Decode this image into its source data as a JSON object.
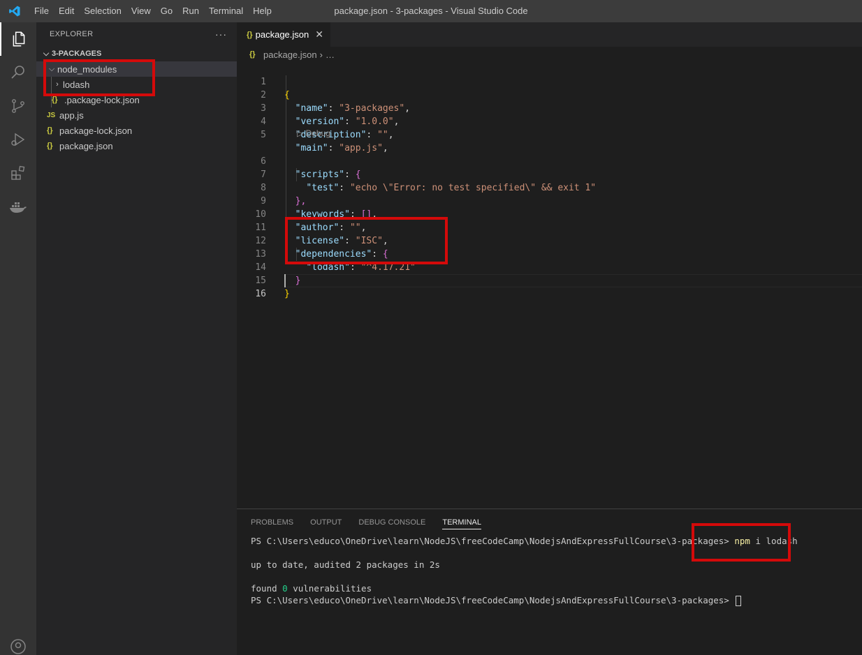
{
  "titlebar": {
    "menu": [
      "File",
      "Edit",
      "Selection",
      "View",
      "Go",
      "Run",
      "Terminal",
      "Help"
    ],
    "window_title": "package.json - 3-packages - Visual Studio Code"
  },
  "activitybar": {
    "icons": [
      "explorer-icon",
      "search-icon",
      "source-control-icon",
      "run-debug-icon",
      "extensions-icon",
      "docker-icon",
      "account-icon"
    ],
    "active": "explorer-icon"
  },
  "sidebar": {
    "title": "EXPLORER",
    "more": "···",
    "section": "3-PACKAGES",
    "tree": [
      {
        "label": "node_modules",
        "kind": "folder-open",
        "depth": 1
      },
      {
        "label": "lodash",
        "kind": "folder-closed",
        "depth": 2
      },
      {
        "label": ".package-lock.json",
        "kind": "json",
        "depth": 2
      },
      {
        "label": "app.js",
        "kind": "js",
        "depth": 1
      },
      {
        "label": "package-lock.json",
        "kind": "json",
        "depth": 1
      },
      {
        "label": "package.json",
        "kind": "json",
        "depth": 1
      }
    ],
    "json_icon": "{}",
    "js_icon": "JS"
  },
  "editor": {
    "tab_label": "package.json",
    "tab_icon": "{}",
    "breadcrumb": [
      "package.json",
      "…"
    ],
    "codelens": "▷ Debug",
    "line_numbers": [
      "1",
      "2",
      "3",
      "4",
      "5",
      "6",
      "7",
      "8",
      "9",
      "10",
      "11",
      "12",
      "13",
      "14",
      "15",
      "16"
    ],
    "lines": {
      "l1": "{",
      "l2_key": "\"name\"",
      "l2_val": "\"3-packages\"",
      "l3_key": "\"version\"",
      "l3_val": "\"1.0.0\"",
      "l4_key": "\"description\"",
      "l4_val": "\"\"",
      "l5_key": "\"main\"",
      "l5_val": "\"app.js\"",
      "l6_key": "\"scripts\"",
      "l6_brace": "{",
      "l7_key": "\"test\"",
      "l7_val": "\"echo \\\"Error: no test specified\\\" && exit 1\"",
      "l8": "},",
      "l9_key": "\"keywords\"",
      "l9_val": "[]",
      "l10_key": "\"author\"",
      "l10_val": "\"\"",
      "l11_key": "\"license\"",
      "l11_val": "\"ISC\"",
      "l12_key": "\"dependencies\"",
      "l12_brace": "{",
      "l13_key": "\"lodash\"",
      "l13_val": "\"^4.17.21\"",
      "l14": "}",
      "l15": "}"
    }
  },
  "panel": {
    "tabs": [
      "PROBLEMS",
      "OUTPUT",
      "DEBUG CONSOLE",
      "TERMINAL"
    ],
    "active_tab": "TERMINAL",
    "terminal": {
      "prompt": "PS C:\\Users\\educo\\OneDrive\\learn\\NodeJS\\freeCodeCamp\\NodejsAndExpressFullCourse\\3-packages>",
      "cmd_name": "npm",
      "cmd_args": " i lodash",
      "line2": "up to date, audited 2 packages in 2s",
      "found_prefix": "found ",
      "found_count": "0",
      "found_suffix": " vulnerabilities"
    }
  },
  "annotations": {
    "highlight_color": "#d40a0a"
  }
}
